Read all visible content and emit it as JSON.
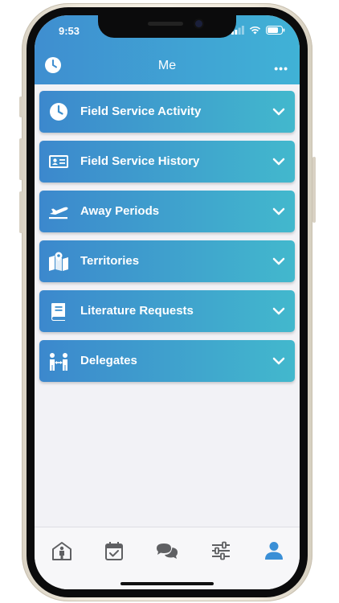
{
  "status_bar": {
    "time": "9:53"
  },
  "header": {
    "title": "Me",
    "left_icon": "clock-icon",
    "right_icon": "more-icon"
  },
  "sections": [
    {
      "label": "Field Service Activity",
      "icon": "clock-icon"
    },
    {
      "label": "Field Service History",
      "icon": "id-card-icon"
    },
    {
      "label": "Away Periods",
      "icon": "airplane-icon"
    },
    {
      "label": "Territories",
      "icon": "map-icon"
    },
    {
      "label": "Literature Requests",
      "icon": "book-icon"
    },
    {
      "label": "Delegates",
      "icon": "people-icon"
    }
  ],
  "tabs": [
    {
      "icon": "home-person-icon",
      "active": false
    },
    {
      "icon": "calendar-check-icon",
      "active": false
    },
    {
      "icon": "chat-icon",
      "active": false
    },
    {
      "icon": "sliders-icon",
      "active": false
    },
    {
      "icon": "user-icon",
      "active": true
    }
  ],
  "colors": {
    "accent_start": "#3c88cd",
    "accent_end": "#42b8cd",
    "tab_inactive": "#5f6063",
    "tab_active": "#3a8fd6"
  }
}
